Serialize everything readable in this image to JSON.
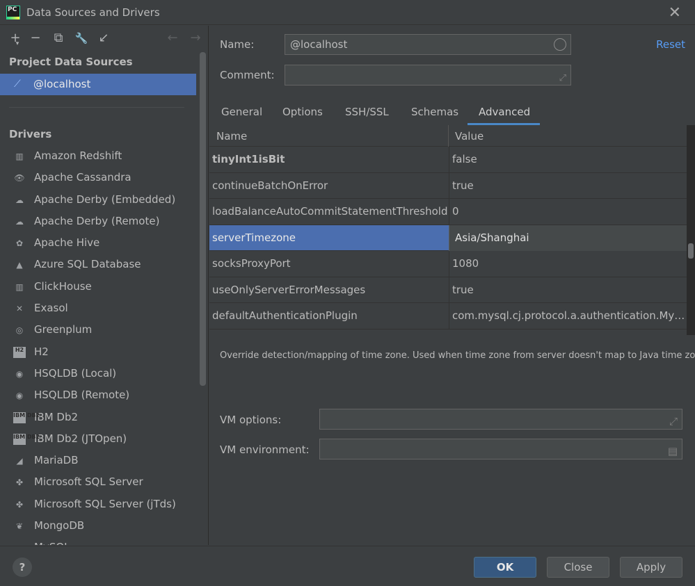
{
  "window": {
    "title": "Data Sources and Drivers",
    "app_icon_text": "PC"
  },
  "toolbar": {
    "add": "+",
    "add_caret": "▾",
    "remove": "−",
    "copy": "⧉",
    "properties": "🔧",
    "import": "↙",
    "back": "←",
    "forward": "→"
  },
  "left": {
    "project_title": "Project Data Sources",
    "selected_source": "@localhost",
    "drivers_title": "Drivers",
    "drivers": [
      {
        "label": "Amazon Redshift",
        "icon": "redshift-icon",
        "glyph": "▥"
      },
      {
        "label": "Apache Cassandra",
        "icon": "cassandra-icon",
        "glyph": "👁"
      },
      {
        "label": "Apache Derby (Embedded)",
        "icon": "derby-icon",
        "glyph": "☁"
      },
      {
        "label": "Apache Derby (Remote)",
        "icon": "derby-icon",
        "glyph": "☁"
      },
      {
        "label": "Apache Hive",
        "icon": "hive-icon",
        "glyph": "✿"
      },
      {
        "label": "Azure SQL Database",
        "icon": "azure-icon",
        "glyph": "▲"
      },
      {
        "label": "ClickHouse",
        "icon": "clickhouse-icon",
        "glyph": "▥"
      },
      {
        "label": "Exasol",
        "icon": "exasol-icon",
        "glyph": "✕"
      },
      {
        "label": "Greenplum",
        "icon": "greenplum-icon",
        "glyph": "◎"
      },
      {
        "label": "H2",
        "icon": "h2-icon",
        "glyph": "H2"
      },
      {
        "label": "HSQLDB (Local)",
        "icon": "hsqldb-icon",
        "glyph": "◉"
      },
      {
        "label": "HSQLDB (Remote)",
        "icon": "hsqldb-icon",
        "glyph": "◉"
      },
      {
        "label": "IBM Db2",
        "icon": "db2-icon",
        "glyph": "IBM DB2"
      },
      {
        "label": "IBM Db2 (JTOpen)",
        "icon": "db2-icon",
        "glyph": "IBM DB2"
      },
      {
        "label": "MariaDB",
        "icon": "mariadb-icon",
        "glyph": "◢"
      },
      {
        "label": "Microsoft SQL Server",
        "icon": "mssql-icon",
        "glyph": "✤"
      },
      {
        "label": "Microsoft SQL Server (jTds)",
        "icon": "mssql-icon",
        "glyph": "✤"
      },
      {
        "label": "MongoDB",
        "icon": "mongodb-icon",
        "glyph": "❦"
      },
      {
        "label": "MySQL",
        "icon": "mysql-icon",
        "glyph": "⛀"
      }
    ]
  },
  "form": {
    "name_label": "Name:",
    "name_value": "@localhost",
    "comment_label": "Comment:",
    "comment_value": "",
    "reset": "Reset"
  },
  "tabs": [
    "General",
    "Options",
    "SSH/SSL",
    "Schemas",
    "Advanced"
  ],
  "table": {
    "col_name": "Name",
    "col_value": "Value",
    "rows": [
      {
        "name": "tinyInt1isBit",
        "value": "false"
      },
      {
        "name": "continueBatchOnError",
        "value": "true"
      },
      {
        "name": "loadBalanceAutoCommitStatementThreshold",
        "value": "0"
      },
      {
        "name": "serverTimezone",
        "value": "Asia/Shanghai"
      },
      {
        "name": "socksProxyPort",
        "value": "1080"
      },
      {
        "name": "useOnlyServerErrorMessages",
        "value": "true"
      },
      {
        "name": "defaultAuthenticationPlugin",
        "value": "com.mysql.cj.protocol.a.authentication.MysqlNativePasswordPlugin"
      }
    ]
  },
  "description": "Override detection/mapping of time zone. Used when time zone from server doesn't map to Java time zone",
  "vm": {
    "options_label": "VM options:",
    "options_value": "",
    "env_label": "VM environment:",
    "env_value": ""
  },
  "footer": {
    "help": "?",
    "ok": "OK",
    "close": "Close",
    "apply": "Apply"
  }
}
